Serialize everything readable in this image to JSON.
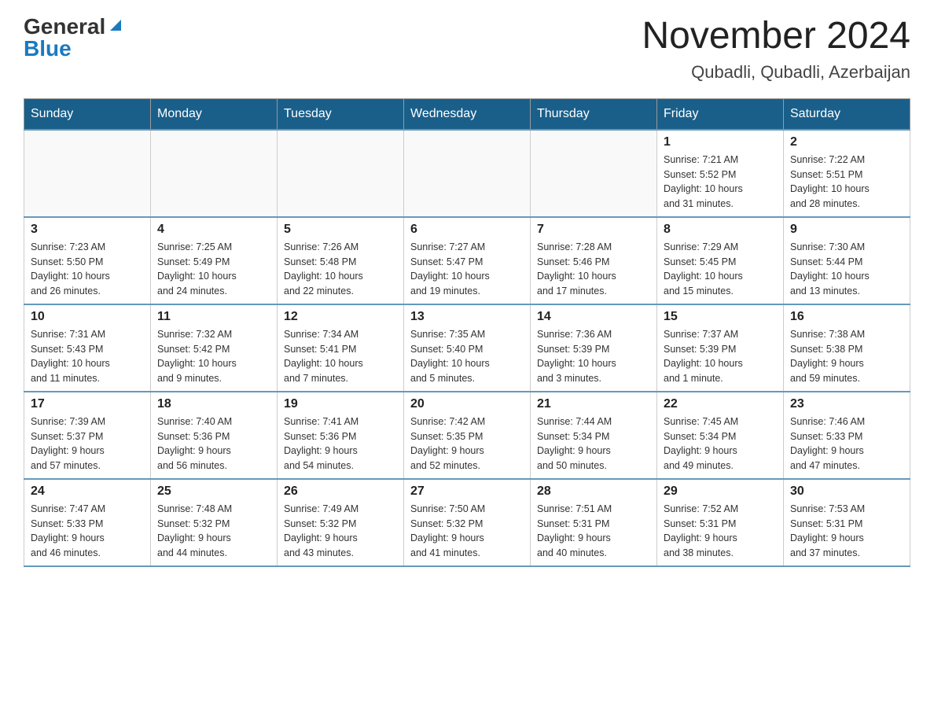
{
  "header": {
    "logo_general": "General",
    "logo_blue": "Blue",
    "month_title": "November 2024",
    "location": "Qubadli, Qubadli, Azerbaijan"
  },
  "weekdays": [
    "Sunday",
    "Monday",
    "Tuesday",
    "Wednesday",
    "Thursday",
    "Friday",
    "Saturday"
  ],
  "weeks": [
    [
      {
        "day": "",
        "info": ""
      },
      {
        "day": "",
        "info": ""
      },
      {
        "day": "",
        "info": ""
      },
      {
        "day": "",
        "info": ""
      },
      {
        "day": "",
        "info": ""
      },
      {
        "day": "1",
        "info": "Sunrise: 7:21 AM\nSunset: 5:52 PM\nDaylight: 10 hours\nand 31 minutes."
      },
      {
        "day": "2",
        "info": "Sunrise: 7:22 AM\nSunset: 5:51 PM\nDaylight: 10 hours\nand 28 minutes."
      }
    ],
    [
      {
        "day": "3",
        "info": "Sunrise: 7:23 AM\nSunset: 5:50 PM\nDaylight: 10 hours\nand 26 minutes."
      },
      {
        "day": "4",
        "info": "Sunrise: 7:25 AM\nSunset: 5:49 PM\nDaylight: 10 hours\nand 24 minutes."
      },
      {
        "day": "5",
        "info": "Sunrise: 7:26 AM\nSunset: 5:48 PM\nDaylight: 10 hours\nand 22 minutes."
      },
      {
        "day": "6",
        "info": "Sunrise: 7:27 AM\nSunset: 5:47 PM\nDaylight: 10 hours\nand 19 minutes."
      },
      {
        "day": "7",
        "info": "Sunrise: 7:28 AM\nSunset: 5:46 PM\nDaylight: 10 hours\nand 17 minutes."
      },
      {
        "day": "8",
        "info": "Sunrise: 7:29 AM\nSunset: 5:45 PM\nDaylight: 10 hours\nand 15 minutes."
      },
      {
        "day": "9",
        "info": "Sunrise: 7:30 AM\nSunset: 5:44 PM\nDaylight: 10 hours\nand 13 minutes."
      }
    ],
    [
      {
        "day": "10",
        "info": "Sunrise: 7:31 AM\nSunset: 5:43 PM\nDaylight: 10 hours\nand 11 minutes."
      },
      {
        "day": "11",
        "info": "Sunrise: 7:32 AM\nSunset: 5:42 PM\nDaylight: 10 hours\nand 9 minutes."
      },
      {
        "day": "12",
        "info": "Sunrise: 7:34 AM\nSunset: 5:41 PM\nDaylight: 10 hours\nand 7 minutes."
      },
      {
        "day": "13",
        "info": "Sunrise: 7:35 AM\nSunset: 5:40 PM\nDaylight: 10 hours\nand 5 minutes."
      },
      {
        "day": "14",
        "info": "Sunrise: 7:36 AM\nSunset: 5:39 PM\nDaylight: 10 hours\nand 3 minutes."
      },
      {
        "day": "15",
        "info": "Sunrise: 7:37 AM\nSunset: 5:39 PM\nDaylight: 10 hours\nand 1 minute."
      },
      {
        "day": "16",
        "info": "Sunrise: 7:38 AM\nSunset: 5:38 PM\nDaylight: 9 hours\nand 59 minutes."
      }
    ],
    [
      {
        "day": "17",
        "info": "Sunrise: 7:39 AM\nSunset: 5:37 PM\nDaylight: 9 hours\nand 57 minutes."
      },
      {
        "day": "18",
        "info": "Sunrise: 7:40 AM\nSunset: 5:36 PM\nDaylight: 9 hours\nand 56 minutes."
      },
      {
        "day": "19",
        "info": "Sunrise: 7:41 AM\nSunset: 5:36 PM\nDaylight: 9 hours\nand 54 minutes."
      },
      {
        "day": "20",
        "info": "Sunrise: 7:42 AM\nSunset: 5:35 PM\nDaylight: 9 hours\nand 52 minutes."
      },
      {
        "day": "21",
        "info": "Sunrise: 7:44 AM\nSunset: 5:34 PM\nDaylight: 9 hours\nand 50 minutes."
      },
      {
        "day": "22",
        "info": "Sunrise: 7:45 AM\nSunset: 5:34 PM\nDaylight: 9 hours\nand 49 minutes."
      },
      {
        "day": "23",
        "info": "Sunrise: 7:46 AM\nSunset: 5:33 PM\nDaylight: 9 hours\nand 47 minutes."
      }
    ],
    [
      {
        "day": "24",
        "info": "Sunrise: 7:47 AM\nSunset: 5:33 PM\nDaylight: 9 hours\nand 46 minutes."
      },
      {
        "day": "25",
        "info": "Sunrise: 7:48 AM\nSunset: 5:32 PM\nDaylight: 9 hours\nand 44 minutes."
      },
      {
        "day": "26",
        "info": "Sunrise: 7:49 AM\nSunset: 5:32 PM\nDaylight: 9 hours\nand 43 minutes."
      },
      {
        "day": "27",
        "info": "Sunrise: 7:50 AM\nSunset: 5:32 PM\nDaylight: 9 hours\nand 41 minutes."
      },
      {
        "day": "28",
        "info": "Sunrise: 7:51 AM\nSunset: 5:31 PM\nDaylight: 9 hours\nand 40 minutes."
      },
      {
        "day": "29",
        "info": "Sunrise: 7:52 AM\nSunset: 5:31 PM\nDaylight: 9 hours\nand 38 minutes."
      },
      {
        "day": "30",
        "info": "Sunrise: 7:53 AM\nSunset: 5:31 PM\nDaylight: 9 hours\nand 37 minutes."
      }
    ]
  ]
}
